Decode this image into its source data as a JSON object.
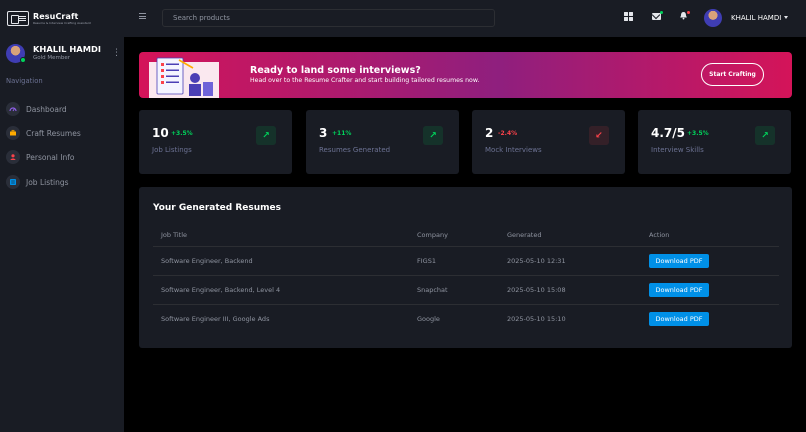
{
  "brand": {
    "name": "ResuCraft",
    "tagline": "Resume & Interview Crafting Assistant"
  },
  "profile": {
    "name": "KHALIL HAMDI",
    "rank": "Gold Member"
  },
  "sidebar": {
    "category": "Navigation",
    "items": [
      {
        "label": "Dashboard",
        "icon": "speedometer-icon",
        "color": "#8f5fe8"
      },
      {
        "label": "Craft Resumes",
        "icon": "briefcase-icon",
        "color": "#ffab00"
      },
      {
        "label": "Personal Info",
        "icon": "user-icon",
        "color": "#fc424a"
      },
      {
        "label": "Job Listings",
        "icon": "list-icon",
        "color": "#0090e7"
      }
    ]
  },
  "topbar": {
    "search_placeholder": "Search products",
    "user_name": "KHALIL HAMDI"
  },
  "banner": {
    "title": "Ready to land some interviews?",
    "subtitle": "Head over to the Resume Crafter and start building tailored resumes now.",
    "button": "Start Crafting"
  },
  "stats": [
    {
      "value": "10",
      "change": "+3.5%",
      "label": "Job Listings",
      "trend": "up"
    },
    {
      "value": "3",
      "change": "+11%",
      "label": "Resumes Generated",
      "trend": "up"
    },
    {
      "value": "2",
      "change": "-2.4%",
      "label": "Mock Interviews",
      "trend": "down"
    },
    {
      "value": "4.7/5",
      "change": "+3.5%",
      "label": "Interview Skills",
      "trend": "up"
    }
  ],
  "table": {
    "title": "Your Generated Resumes",
    "headers": [
      "Job Title",
      "Company",
      "Generated",
      "Action"
    ],
    "rows": [
      {
        "job": "Software Engineer, Backend",
        "company": "FIGS1",
        "date": "2025-05-10 12:31",
        "action": "Download PDF"
      },
      {
        "job": "Software Engineer, Backend, Level 4",
        "company": "Snapchat",
        "date": "2025-05-10 15:08",
        "action": "Download PDF"
      },
      {
        "job": "Software Engineer III, Google Ads",
        "company": "Google",
        "date": "2025-05-10 15:10",
        "action": "Download PDF"
      }
    ]
  },
  "colors": {
    "accent_green": "#00d25b",
    "accent_red": "#fc424a",
    "accent_blue": "#0090e7",
    "banner_pink": "#d41459",
    "banner_purple": "#8f1f7e"
  }
}
